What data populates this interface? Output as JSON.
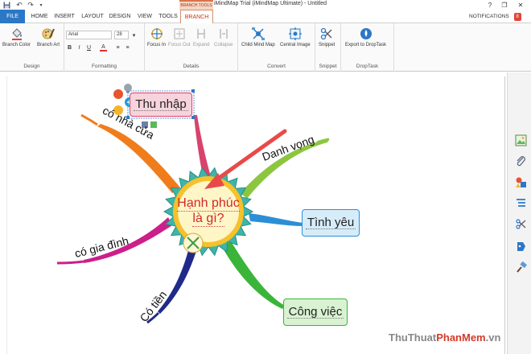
{
  "titlebar": {
    "context_tab_caption": "BRANCH TOOLS",
    "title": "iMindMap Trial (iMindMap Ultimate) - Untitled",
    "help": "?",
    "restore": "❐",
    "close": "✕"
  },
  "tabs": {
    "file": "FILE",
    "home": "HOME",
    "insert": "INSERT",
    "layout": "LAYOUT",
    "design": "DESIGN",
    "view": "VIEW",
    "tools": "TOOLS",
    "branch": "BRANCH",
    "notifications": "NOTIFICATIONS",
    "notification_count": "8"
  },
  "ribbon": {
    "design_group": {
      "label": "Design",
      "branch_color": "Branch Color",
      "branch_art": "Branch Art"
    },
    "formatting_group": {
      "label": "Formatting",
      "font_name": "Arial",
      "font_size": "28",
      "bold": "B",
      "italic": "I",
      "underline": "U",
      "font_color": "A"
    },
    "details_group": {
      "label": "Details",
      "focus_in": "Focus In",
      "focus_out": "Focus Out",
      "expand": "Expand",
      "collapse": "Collapse"
    },
    "convert_group": {
      "label": "Convert",
      "child_mind_map": "Child Mind Map",
      "central_image": "Central Image"
    },
    "snippet_group": {
      "label": "Snippet",
      "snippet": "Snippet"
    },
    "droptask_group": {
      "label": "DropTask",
      "export": "Export to DropTask"
    }
  },
  "mindmap": {
    "central_idea": {
      "line1": "Hạnh phúc",
      "line2": "là gì?"
    },
    "boxed_topics": {
      "thu_nhap": "Thu nhập",
      "tinh_yeu": "Tình yêu",
      "cong_viec": "Công việc"
    },
    "branch_labels": {
      "co_nha_cua": "có nhà cửa",
      "danh_vong": "Danh vọng",
      "co_gia_dinh": "có gia đình",
      "co_tien": "Có tiền"
    },
    "colors": {
      "thu_nhap": "#d8436c",
      "co_nha_cua": "#f07d1c",
      "danh_vong": "#8cc63f",
      "tinh_yeu": "#2c8fd6",
      "cong_viec": "#3ab53a",
      "co_gia_dinh": "#cc1f8a",
      "co_tien": "#1f2a8a",
      "arrow": "#e84a4a"
    }
  },
  "watermark": {
    "part1": "ThuThuat",
    "part2": "PhanMem",
    "part3": ".vn"
  }
}
